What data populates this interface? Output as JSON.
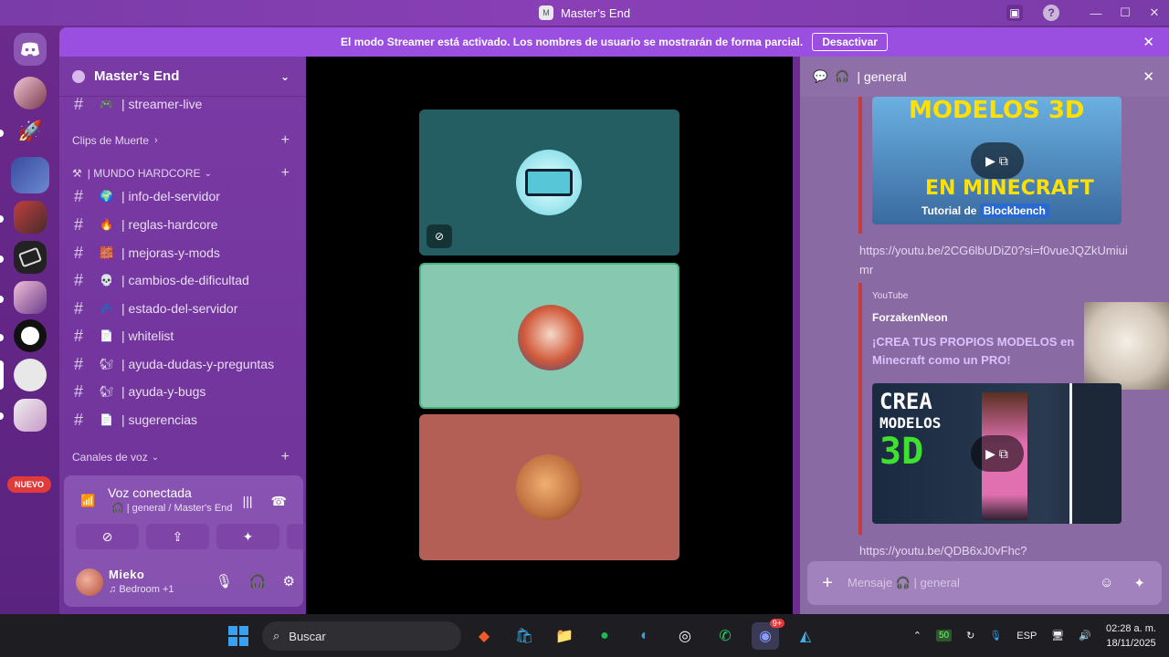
{
  "window": {
    "title": "Master’s End"
  },
  "banner": {
    "text": "El modo Streamer está activado. Los nombres de usuario se mostrarán de forma parcial.",
    "button": "Desactivar"
  },
  "rail": {
    "new_badge": "NUEVO"
  },
  "server": {
    "name": "Master’s End"
  },
  "channels": [
    {
      "emoji": "🎮",
      "name": "| streamer-live"
    },
    {
      "emoji": "🌍",
      "name": "| info-del-servidor"
    },
    {
      "emoji": "🔥",
      "name": "| reglas-hardcore"
    },
    {
      "emoji": "🧱",
      "name": "| mejoras-y-mods"
    },
    {
      "emoji": "💀",
      "name": "| cambios-de-dificultad"
    },
    {
      "emoji": "💤",
      "name": "| estado-del-servidor"
    },
    {
      "emoji": "📄",
      "name": "| whitelist"
    },
    {
      "emoji": "🐿",
      "name": "| ayuda-dudas-y-preguntas"
    },
    {
      "emoji": "🐿",
      "name": "| ayuda-y-bugs"
    },
    {
      "emoji": "📄",
      "name": "| sugerencias"
    }
  ],
  "categories": {
    "clips": "Clips de Muerte",
    "hardcore": "| MUNDO HARDCORE",
    "voice": "Canales de voz"
  },
  "voice": {
    "status": "Voz conectada",
    "channel": "| general / Master's End"
  },
  "user": {
    "name": "Mieko",
    "activity": "Bedroom +1"
  },
  "chat": {
    "channel": "| general",
    "thumb1": {
      "top_text": "MODELOS 3D",
      "bottom_text": "EN MINECRAFT",
      "tag": "Tutorial de",
      "brand": "Blockbench"
    },
    "link1": "https://youtu.be/2CG6lbUDiZ0?si=f0vueJQZkUmiuimr",
    "embed": {
      "provider": "YouTube",
      "author": "ForzakenNeon",
      "title": "¡CREA TUS PROPIOS MODELOS en Minecraft como un PRO!"
    },
    "thumb2": {
      "line1": "CREA",
      "line2": "MODELOS",
      "line3": "3D"
    },
    "link2": "https://youtu.be/QDB6xJ0vFhc?",
    "placeholder": "Mensaje 🎧 | general"
  },
  "taskbar": {
    "search": "Buscar",
    "lang": "ESP",
    "time": "02:28 a. m.",
    "date": "18/11/2025",
    "discord_badge": "9+",
    "tray_badge": "50"
  },
  "colors": {
    "banner": "#9a4fe0",
    "tile_top": "#255e62",
    "tile_mid": "#86c8b0",
    "tile_bot": "#b35f55",
    "speaking": "#43b581"
  }
}
